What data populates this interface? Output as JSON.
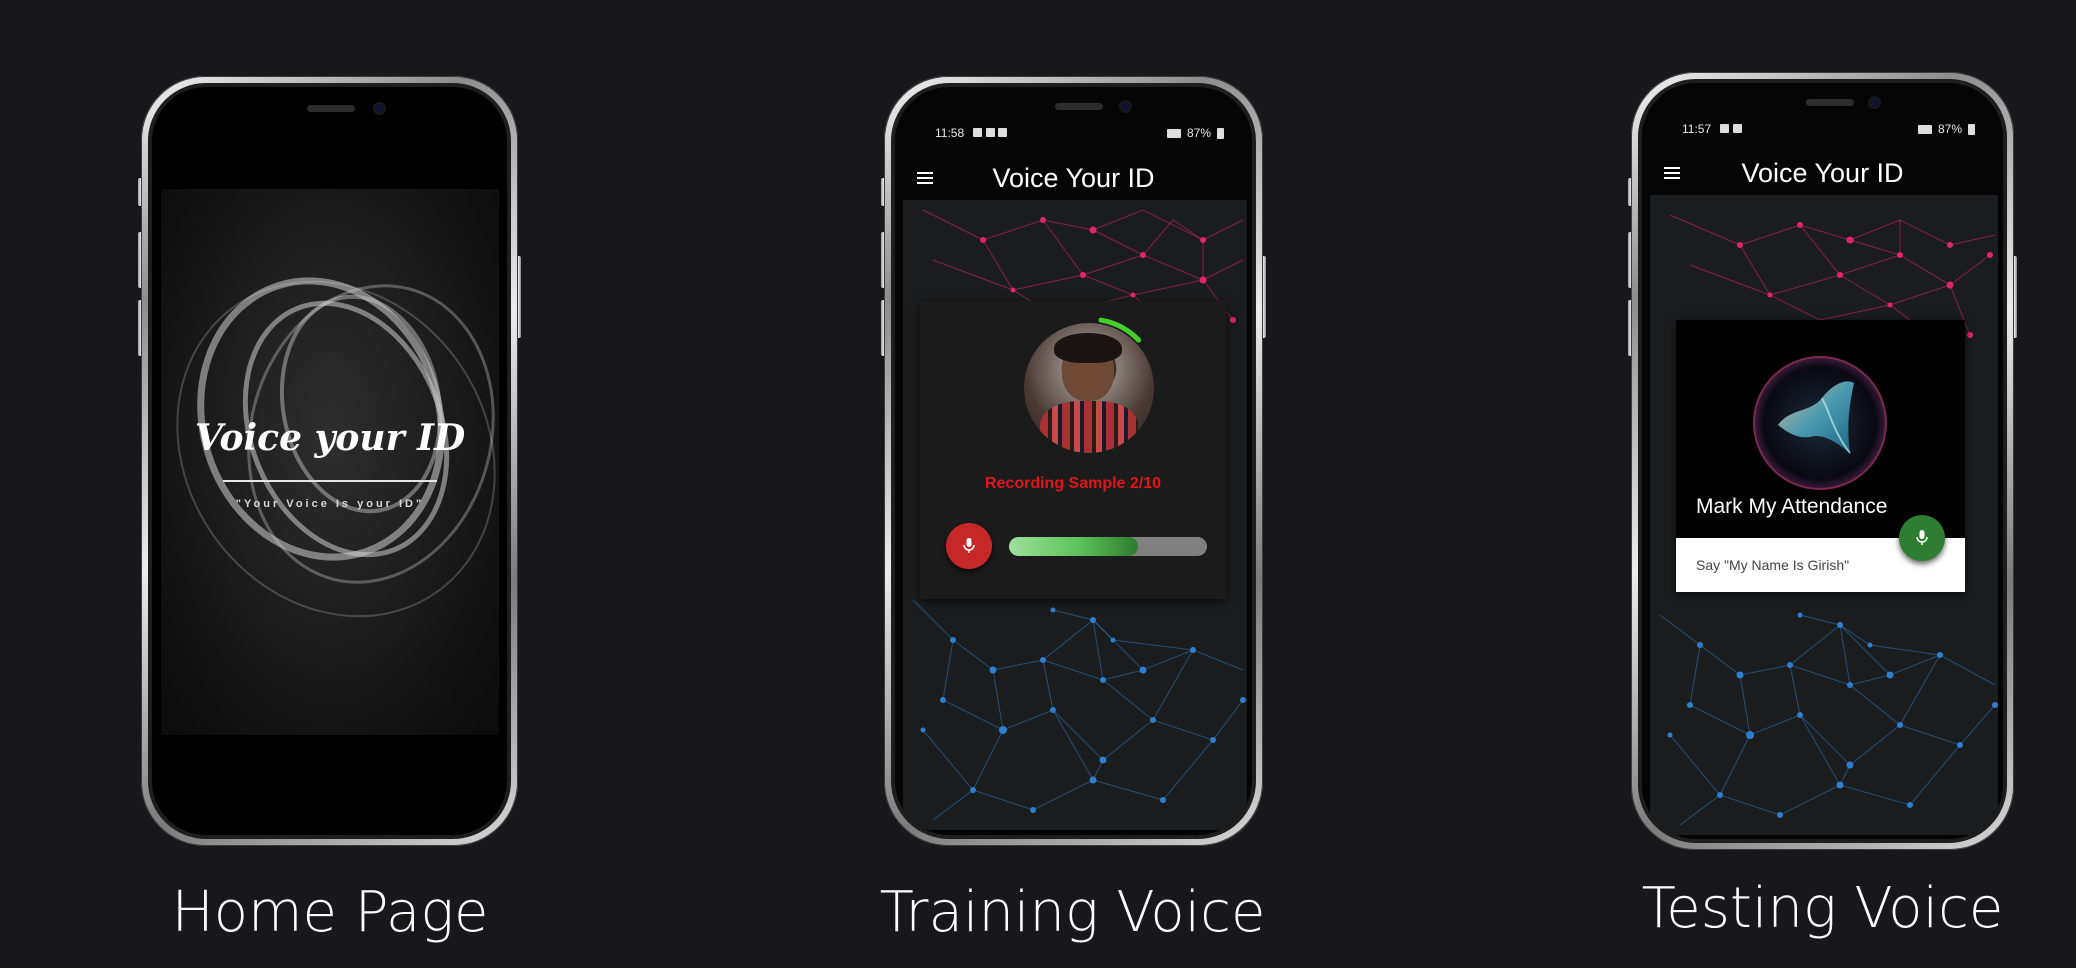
{
  "phones": {
    "home": {
      "logo_title": "Voice your ID",
      "tagline": "\"Your Voice Is your ID\"",
      "caption": "Home Page"
    },
    "training": {
      "status_time": "11:58",
      "status_battery": "87%",
      "app_title": "Voice Your ID",
      "status_text": "Recording Sample 2/10",
      "progress_fraction": 0.65,
      "caption": "Training Voice",
      "mic_icon": "mic-icon",
      "menu_icon": "menu-icon"
    },
    "testing": {
      "status_time": "11:57",
      "status_battery": "87%",
      "app_title": "Voice Your ID",
      "card_title": "Mark My Attendance",
      "prompt": "Say \"My Name Is Girish\"",
      "caption": "Testing Voice",
      "mic_icon": "mic-icon",
      "menu_icon": "menu-icon"
    }
  },
  "colors": {
    "background": "#17171c",
    "record_red": "#c62828",
    "status_red": "#e0161b",
    "progress_green": "#5cc15a",
    "mic_green": "#2e7d32",
    "network_pink": "#e0246f",
    "network_blue": "#2f7fd0"
  }
}
